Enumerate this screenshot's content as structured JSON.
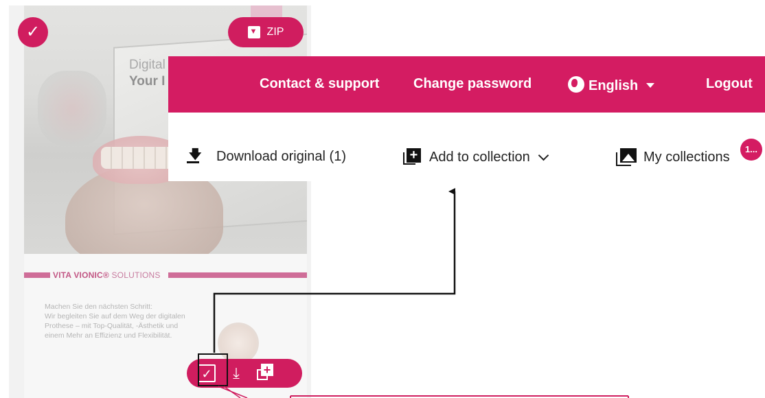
{
  "header": {
    "contact_support": "Contact & support",
    "change_password": "Change password",
    "language": "English",
    "logout": "Logout"
  },
  "toolbar": {
    "download_original": "Download original (1)",
    "add_to_collection": "Add to collection",
    "my_collections": "My collections",
    "collections_badge": "1..."
  },
  "card": {
    "zip_label": "ZIP",
    "photo_title_line1": "Digital",
    "photo_title_line2": "Your I",
    "band_brand": "VITA VIONIC®",
    "band_suffix": "SOLUTIONS",
    "description": [
      "Machen Sie den nächsten Schritt:",
      "Wir begleiten Sie auf dem Weg der digitalen",
      "Prothese – mit Top-Qualität, -Ästhetik und",
      "einem Mehr an Effizienz und Flexibilität."
    ]
  },
  "icons": {
    "select": "check-icon",
    "zip": "archive-download-icon",
    "language": "globe-icon",
    "download": "download-icon",
    "add_collection": "add-to-collection-icon",
    "my_collections": "photo-collection-icon"
  },
  "colors": {
    "brand": "#d41c62",
    "toolbar_text": "#222222",
    "annotation": "#111111",
    "annotation_pink": "#d01d5f"
  }
}
